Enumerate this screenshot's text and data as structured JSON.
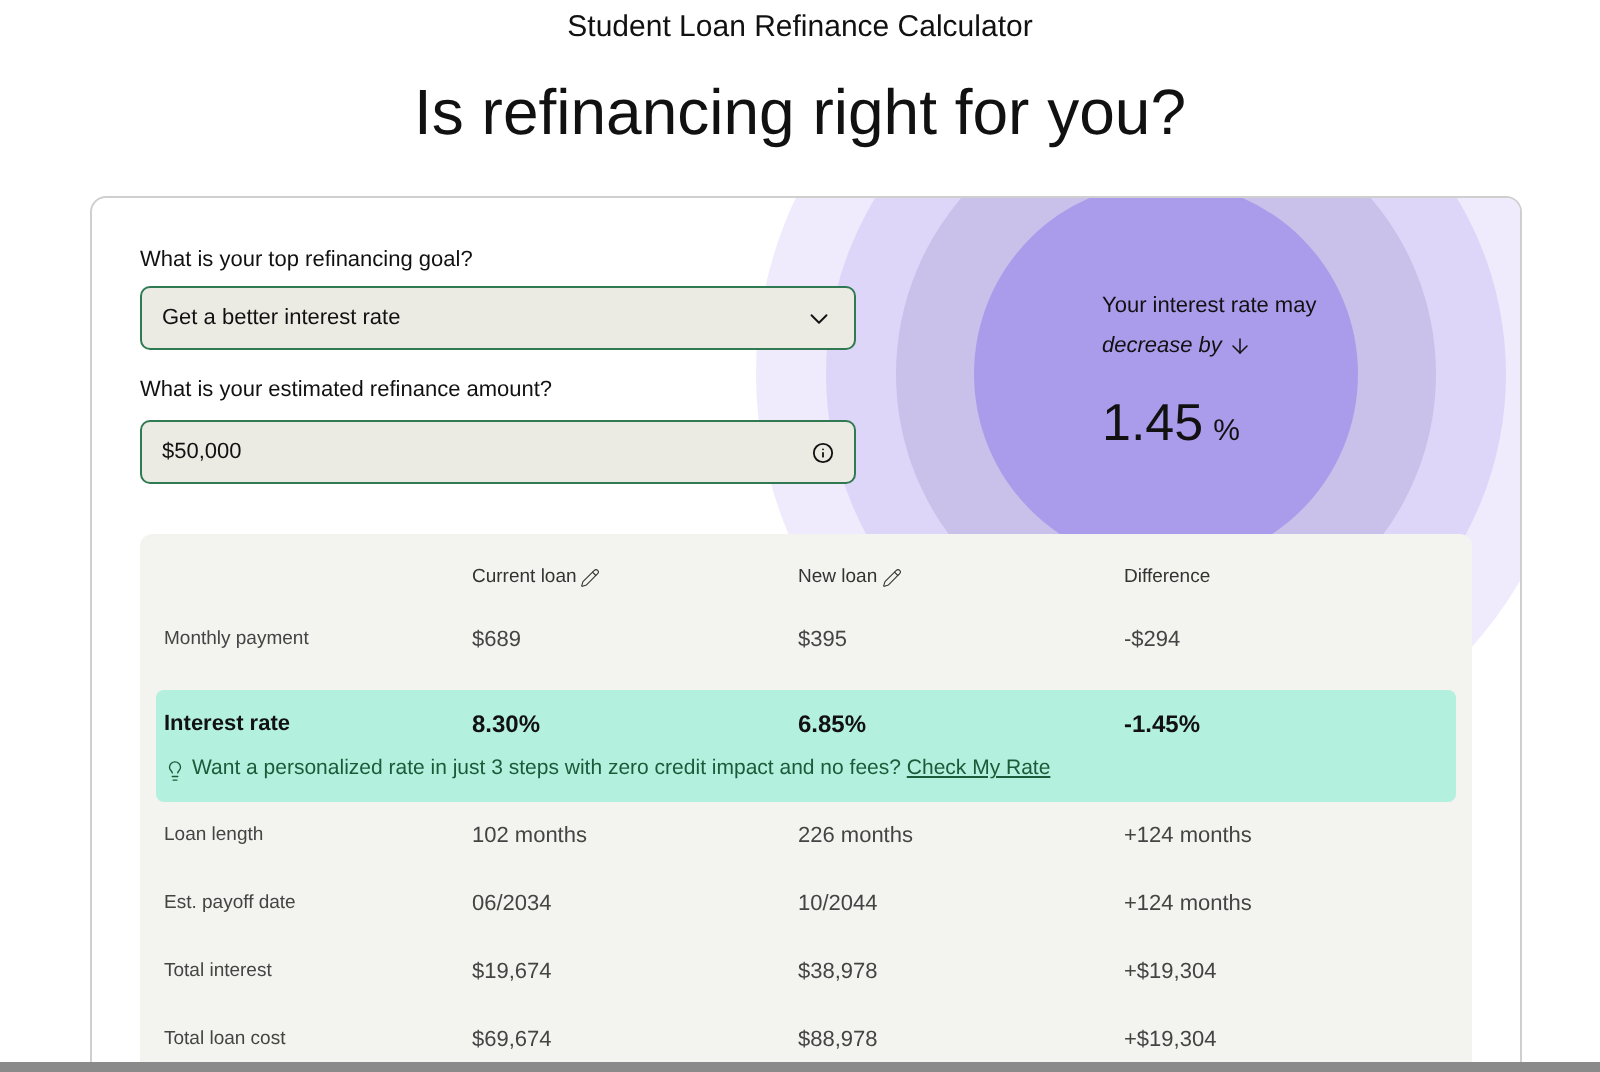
{
  "page_title": "Student Loan Refinance Calculator",
  "heading": "Is refinancing right for you?",
  "goal_field": {
    "label": "What is your top refinancing goal?",
    "value": "Get a better interest rate"
  },
  "amount_field": {
    "label": "What is your estimated refinance amount?",
    "value": "$50,000"
  },
  "rate_result": {
    "line_1": "Your interest rate may",
    "line_2": "decrease by",
    "value": "1.45",
    "unit": "%"
  },
  "table": {
    "columns": [
      {
        "label": "Current loan",
        "editable": true
      },
      {
        "label": "New loan",
        "editable": true
      },
      {
        "label": "Difference",
        "editable": false
      }
    ],
    "rows": [
      {
        "label": "Monthly payment",
        "values": [
          "$689",
          "$395",
          "-$294"
        ],
        "highlighted": false
      },
      {
        "label": "Interest rate",
        "values": [
          "8.30%",
          "6.85%",
          "-1.45%"
        ],
        "highlighted": true,
        "tip": {
          "text": "Want a personalized rate in just 3 steps with zero credit impact and no fees?",
          "link": "Check My Rate"
        }
      },
      {
        "label": "Loan length",
        "values": [
          "102 months",
          "226 months",
          "+124 months"
        ],
        "highlighted": false
      },
      {
        "label": "Est. payoff date",
        "values": [
          "06/2034",
          "10/2044",
          "+124 months"
        ],
        "highlighted": false
      },
      {
        "label": "Total interest",
        "values": [
          "$19,674",
          "$38,978",
          "+$19,304"
        ],
        "highlighted": false
      },
      {
        "label": "Total loan cost",
        "values": [
          "$69,674",
          "$88,978",
          "+$19,304"
        ],
        "highlighted": false
      }
    ]
  }
}
